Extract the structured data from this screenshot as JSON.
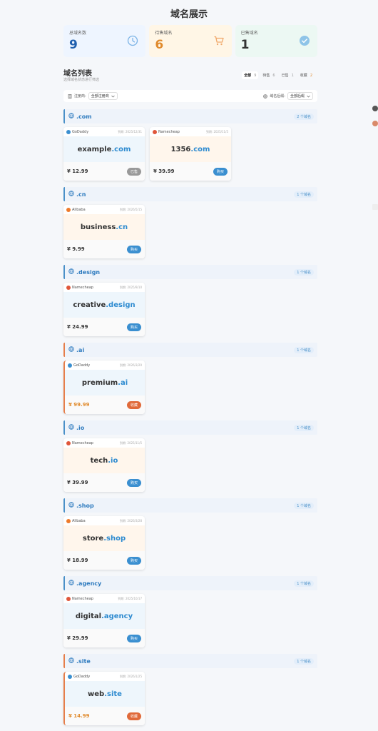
{
  "page_title": "域名展示",
  "stats": {
    "total": {
      "label": "总域名数",
      "value": "9"
    },
    "pending": {
      "label": "待售域名",
      "value": "6"
    },
    "sold": {
      "label": "已售域名",
      "value": "1"
    }
  },
  "list": {
    "title": "域名列表",
    "subtitle": "选择域名状态进行筛选",
    "tabs": [
      {
        "label": "全部",
        "count": "9"
      },
      {
        "label": "待售",
        "count": "6"
      },
      {
        "label": "已售",
        "count": "1"
      },
      {
        "label": "收藏",
        "count": "2"
      }
    ]
  },
  "filters": {
    "registrar_label": "注册商:",
    "registrar_value": "全部注册商",
    "tld_label": "域名后缀:",
    "tld_value": "全部后缀"
  },
  "expire_prefix": "到期:",
  "sections": [
    {
      "tld": ".com",
      "count": "2 个域名",
      "cards": [
        {
          "registrar": "GoDaddy",
          "expire": "2025/12/31",
          "name": "example",
          "suffix": ".com",
          "price": "¥ 12.99",
          "status": "已售",
          "kind": "sold",
          "bg": "blue",
          "reg": "godaddy"
        },
        {
          "registrar": "Namecheap",
          "expire": "2025/11/5",
          "name": "1356",
          "suffix": ".com",
          "price": "¥ 39.99",
          "status": "购买",
          "kind": "buy",
          "bg": "peach",
          "reg": "namecheap"
        }
      ]
    },
    {
      "tld": ".cn",
      "count": "1 个域名",
      "cards": [
        {
          "registrar": "Alibaba",
          "expire": "2026/5/15",
          "name": "business",
          "suffix": ".cn",
          "price": "¥ 9.99",
          "status": "购买",
          "kind": "buy",
          "bg": "peach",
          "reg": "alibaba"
        }
      ]
    },
    {
      "tld": ".design",
      "count": "1 个域名",
      "cards": [
        {
          "registrar": "Namecheap",
          "expire": "2025/9/10",
          "name": "creative",
          "suffix": ".design",
          "price": "¥ 24.99",
          "status": "购买",
          "kind": "buy",
          "bg": "blue",
          "reg": "namecheap"
        }
      ]
    },
    {
      "tld": ".ai",
      "count": "1 个域名",
      "cards": [
        {
          "registrar": "GoDaddy",
          "expire": "2026/3/20",
          "name": "premium",
          "suffix": ".ai",
          "price": "¥ 99.99",
          "status": "收藏",
          "kind": "fav",
          "bg": "blue",
          "reg": "godaddy"
        }
      ]
    },
    {
      "tld": ".io",
      "count": "1 个域名",
      "cards": [
        {
          "registrar": "Namecheap",
          "expire": "2025/11/5",
          "name": "tech",
          "suffix": ".io",
          "price": "¥ 39.99",
          "status": "购买",
          "kind": "buy",
          "bg": "peach",
          "reg": "namecheap"
        }
      ]
    },
    {
      "tld": ".shop",
      "count": "1 个域名",
      "cards": [
        {
          "registrar": "Alibaba",
          "expire": "2026/3/28",
          "name": "store",
          "suffix": ".shop",
          "price": "¥ 18.99",
          "status": "购买",
          "kind": "buy",
          "bg": "peach",
          "reg": "alibaba"
        }
      ]
    },
    {
      "tld": ".agency",
      "count": "1 个域名",
      "cards": [
        {
          "registrar": "Namecheap",
          "expire": "2025/10/17",
          "name": "digital",
          "suffix": ".agency",
          "price": "¥ 29.99",
          "status": "购买",
          "kind": "buy",
          "bg": "blue",
          "reg": "namecheap"
        }
      ]
    },
    {
      "tld": ".site",
      "count": "1 个域名",
      "cards": [
        {
          "registrar": "GoDaddy",
          "expire": "2026/1/25",
          "name": "web",
          "suffix": ".site",
          "price": "¥ 14.99",
          "status": "收藏",
          "kind": "fav",
          "bg": "blue",
          "reg": "godaddy"
        }
      ]
    }
  ],
  "colors": {
    "accent": "#2e8bd0",
    "godaddy": "#3a8fd0",
    "namecheap": "#e0563a",
    "alibaba": "#ee7a2a",
    "fav": "#e06a3a"
  }
}
